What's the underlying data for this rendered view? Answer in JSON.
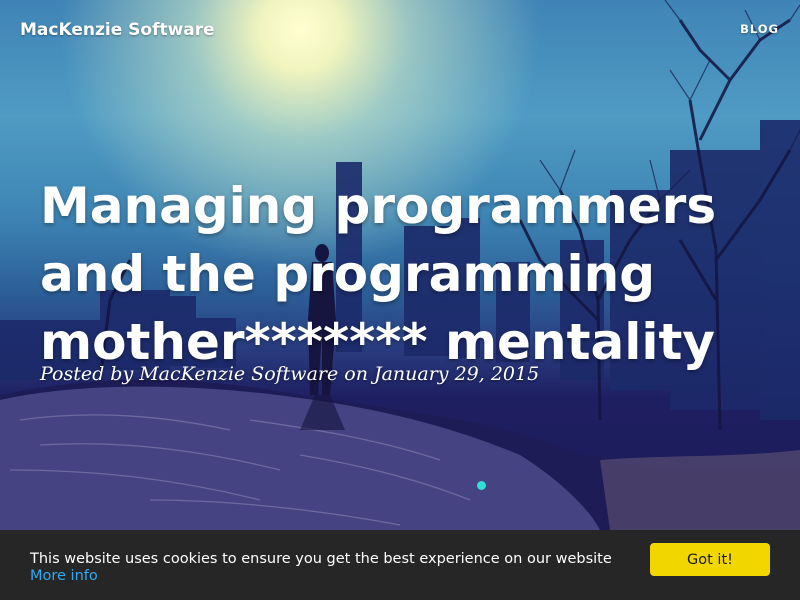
{
  "nav": {
    "brand": "MacKenzie Software",
    "blog_link": "BLOG"
  },
  "post": {
    "title": "Managing programmers and the programming mother******* mentality",
    "meta": "Posted by MacKenzie Software on January 29, 2015"
  },
  "cookie_banner": {
    "message": "This website uses cookies to ensure you get the best experience on our website",
    "more_info_link": "More info",
    "button_label": "Got it!"
  },
  "colors": {
    "cookie_button": "#f1d600",
    "cookie_link": "#31a8f0",
    "cookie_bar": "#262627",
    "accent_dot": "#2fe0d6"
  }
}
